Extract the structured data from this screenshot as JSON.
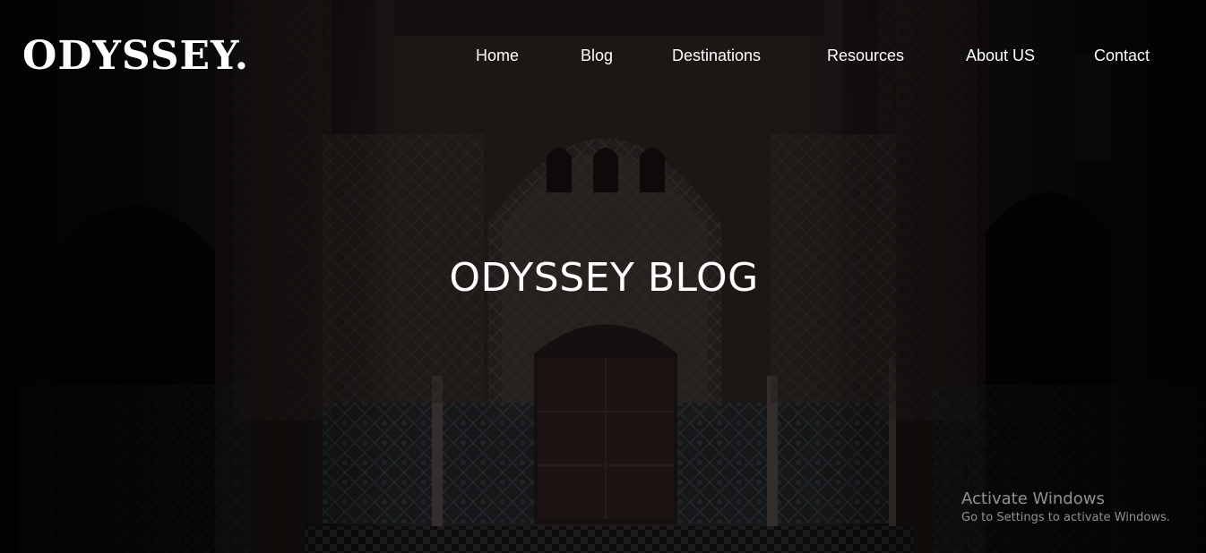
{
  "brand": {
    "logo_text": "ODYSSEY."
  },
  "nav": {
    "items": [
      {
        "label": "Home"
      },
      {
        "label": "Blog"
      },
      {
        "label": "Destinations"
      },
      {
        "label": "Resources"
      },
      {
        "label": "About US"
      },
      {
        "label": "Contact"
      }
    ]
  },
  "hero": {
    "title": "ODYSSEY BLOG",
    "background": "courtyard-arch-photo"
  },
  "os_overlay": {
    "activate_title": "Activate Windows",
    "activate_subtitle": "Go to Settings to activate Windows."
  },
  "colors": {
    "text": "#ffffff",
    "watermark": "#9b9896"
  }
}
